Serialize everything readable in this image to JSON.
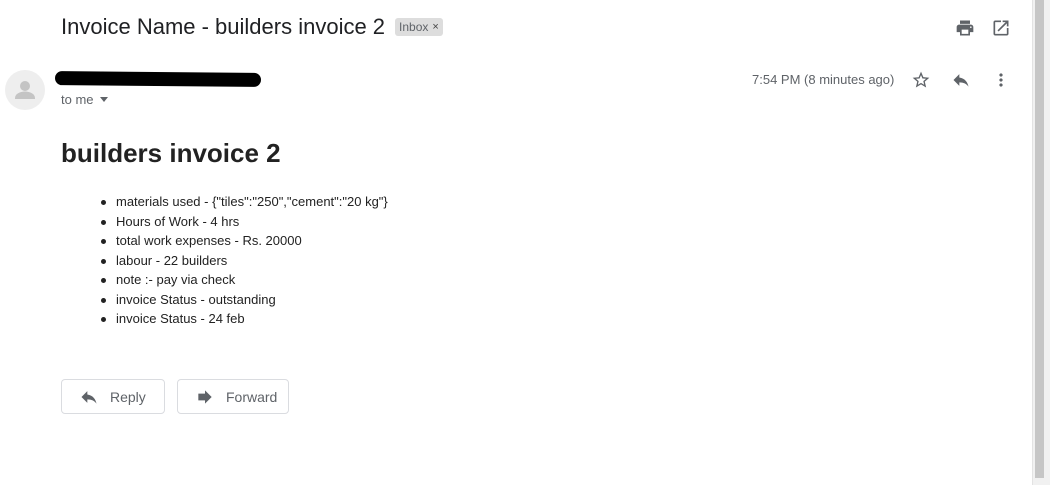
{
  "email": {
    "subject": "Invoice Name - builders invoice 2",
    "label": "Inbox",
    "label_remove": "×",
    "recipient": "to me",
    "timestamp": "7:54 PM (8 minutes ago)",
    "body_title": "builders invoice 2",
    "details": [
      "materials used - {\"tiles\":\"250\",\"cement\":\"20 kg\"}",
      "Hours of Work - 4 hrs",
      "total work expenses - Rs. 20000",
      "labour - 22 builders",
      "note :- pay via check",
      "invoice Status - outstanding",
      "invoice Status - 24 feb"
    ]
  },
  "actions": {
    "reply_label": "Reply",
    "forward_label": "Forward"
  },
  "icons": {
    "print": "print-icon",
    "open_new_window": "open-in-new-window-icon",
    "star": "star-icon",
    "reply": "reply-icon",
    "more": "more-vert-icon",
    "forward": "forward-icon",
    "avatar": "default-avatar-icon"
  },
  "colors": {
    "text": "#202124",
    "secondary": "#5f6368",
    "label_bg": "#dddddd",
    "button_border": "#dadce0"
  }
}
